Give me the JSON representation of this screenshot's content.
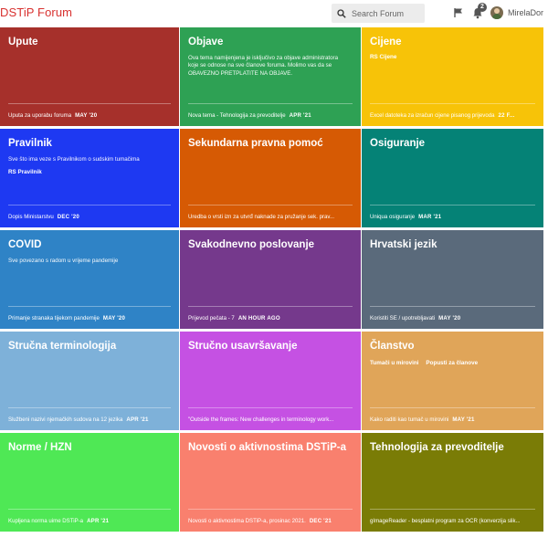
{
  "header": {
    "logo": "DSTiP Forum",
    "search_placeholder": "Search Forum",
    "notification_count": "2",
    "username": "MirelaDor"
  },
  "colors": {
    "upute": "#a6302b",
    "objave": "#2ea154",
    "cijene": "#f7c308",
    "pravilnik": "#1e39f2",
    "sekundarna": "#d65a04",
    "osiguranje": "#058276",
    "covid": "#2f83c6",
    "svakodnevno": "#75398c",
    "hrvatski": "#5a6a7b",
    "strucna_terminologija": "#7eb1d9",
    "strucno_usavrsavanje": "#c551e3",
    "clanstvo": "#e0a559",
    "norme": "#4fe855",
    "novosti": "#f9806e",
    "tehnologija": "#7a7c06"
  },
  "tiles": [
    {
      "title": "Upute",
      "latest": "Uputa za uporabu foruma",
      "date": "MAY '20"
    },
    {
      "title": "Objave",
      "desc": "Ova tema namijenjena je isključivo za objave administratora koje se odnose na sve članove foruma. Molimo vas da se OBAVEZNO PRETPLATITE NA OBJAVE.",
      "latest": "Nova tema - Tehnologija za prevoditelje",
      "date": "APR '21"
    },
    {
      "title": "Cijene",
      "subs": [
        "RS Cijene"
      ],
      "latest": "Excel datoteka za izračun cijene pisanog prijevoda",
      "date": "22 F..."
    },
    {
      "title": "Pravilnik",
      "desc": "Sve što ima veze s Pravilnikom o sudskim tumačima",
      "subs": [
        "RS Pravilnik"
      ],
      "latest": "Dopis Ministarstvu",
      "date": "DEC '20"
    },
    {
      "title": "Sekundarna pravna pomoć",
      "latest": "Uredba o vrsti izn za utvrđ naknade za pružanje sek. prav...",
      "date": ""
    },
    {
      "title": "Osiguranje",
      "latest": "Uniqua osiguranje",
      "date": "MAR '21"
    },
    {
      "title": "COVID",
      "desc": "Sve povezano s radom u vrijeme pandemije",
      "latest": "Primanje stranaka tijekom pandemije",
      "date": "MAY '20"
    },
    {
      "title": "Svakodnevno poslovanje",
      "latest": "Prijevod pečata - 7",
      "date": "AN HOUR AGO"
    },
    {
      "title": "Hrvatski jezik",
      "latest": "Koristiti SE / upotrebljavati",
      "date": "MAY '20"
    },
    {
      "title": "Stručna terminologija",
      "latest": "Službeni nazivi njemačkih sudova na 12 jezika",
      "date": "APR '21"
    },
    {
      "title": "Stručno usavršavanje",
      "latest": "\"Outside the frames: New challenges in terminology work...",
      "date": ""
    },
    {
      "title": "Članstvo",
      "subs": [
        "Tumači u mirovini",
        "Popusti za članove"
      ],
      "latest": "Kako raditi kao tumač u mirovini",
      "date": "MAY '21"
    },
    {
      "title": "Norme / HZN",
      "latest": "Kupljena norma uime DSTiP-a",
      "date": "APR '21"
    },
    {
      "title": "Novosti o aktivnostima DSTiP-a",
      "latest": "Novosti o aktivnostima DSTiP-a, prosinac 2021.",
      "date": "DEC '21"
    },
    {
      "title": "Tehnologija za prevoditelje",
      "latest": "gImageReader - besplatni program za OCR (konverzija slik...",
      "date": ""
    }
  ]
}
